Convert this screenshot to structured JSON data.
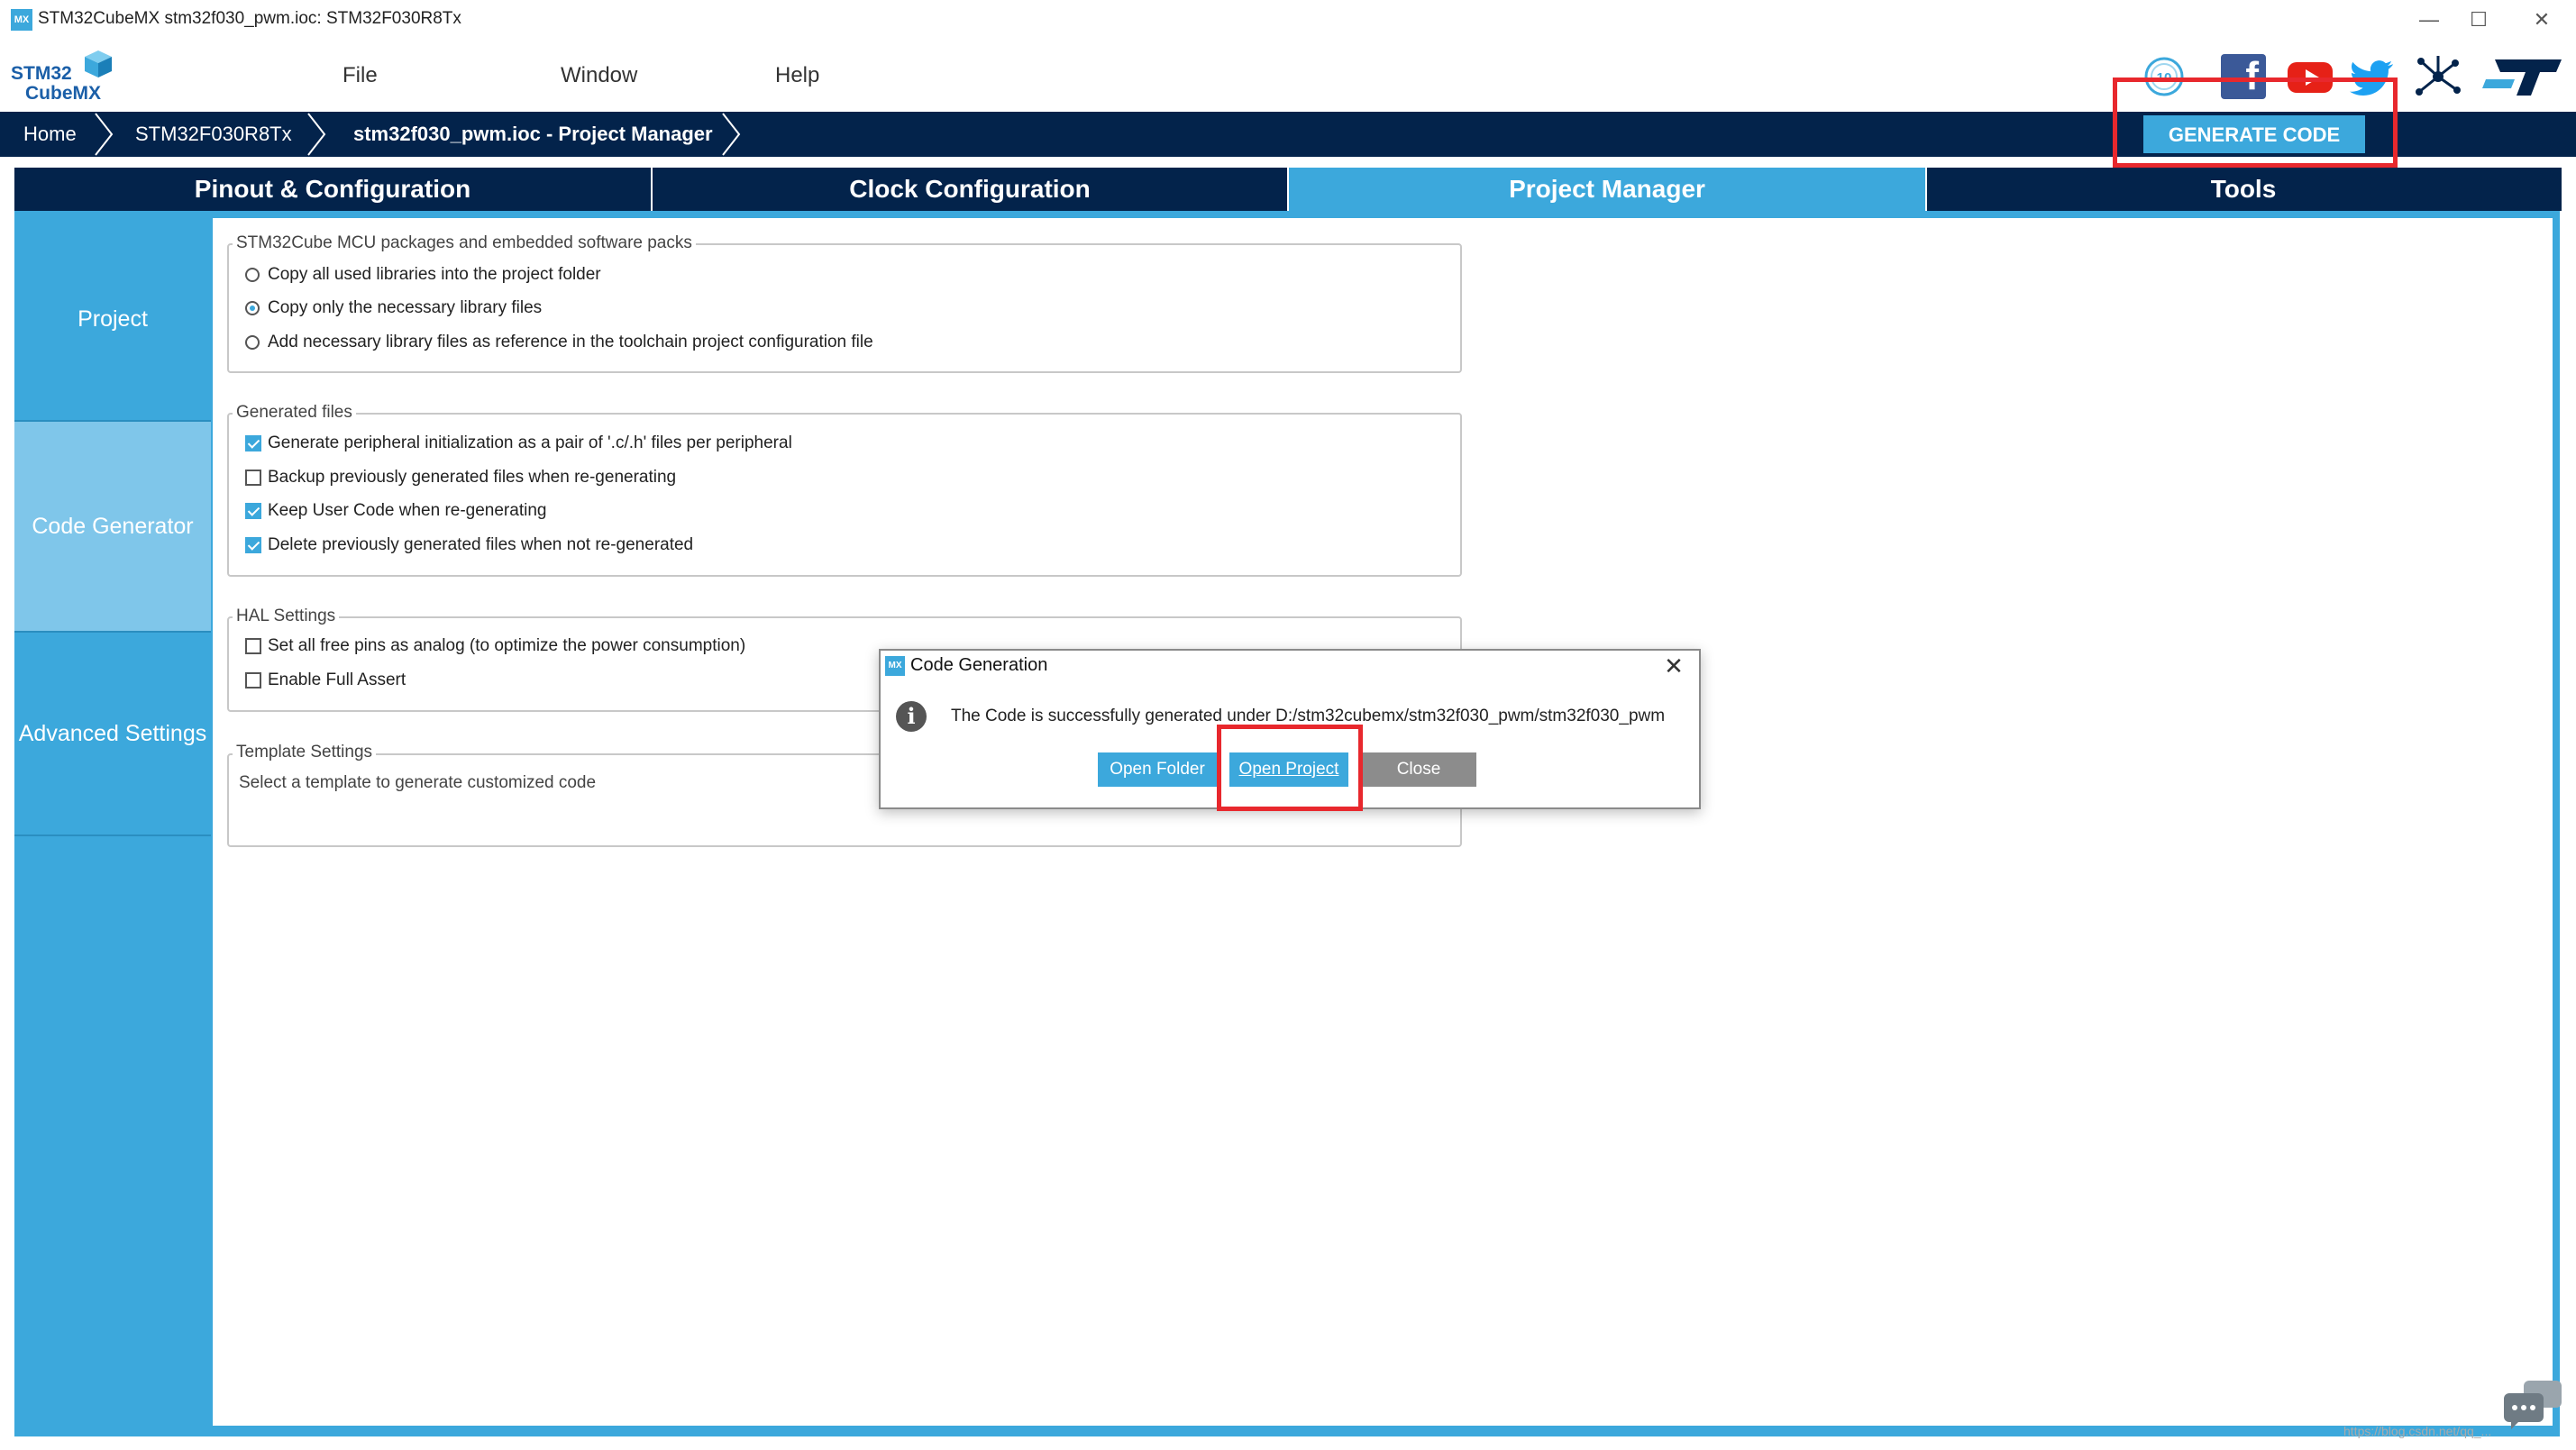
{
  "window": {
    "icon_text": "MX",
    "title": "STM32CubeMX stm32f030_pwm.ioc: STM32F030R8Tx",
    "minimize": "—",
    "maximize": "☐",
    "close": "✕"
  },
  "logo": {
    "line1": "STM32",
    "line2": "CubeMX"
  },
  "menu": [
    "File",
    "Window",
    "Help"
  ],
  "social_icons": [
    "anniversary-icon",
    "facebook-icon",
    "youtube-icon",
    "twitter-icon",
    "network-icon",
    "st-logo-icon"
  ],
  "social": {
    "facebook": "f",
    "st": "ST"
  },
  "breadcrumb": [
    "Home",
    "STM32F030R8Tx",
    "stm32f030_pwm.ioc - Project Manager"
  ],
  "generate_button": "GENERATE CODE",
  "tabs": [
    "Pinout & Configuration",
    "Clock Configuration",
    "Project Manager",
    "Tools"
  ],
  "active_tab": "Project Manager",
  "sidebar": [
    "Project",
    "Code Generator",
    "Advanced Settings"
  ],
  "active_sidebar": "Code Generator",
  "groups": {
    "packs": {
      "legend": "STM32Cube MCU packages and embedded software packs",
      "options": [
        {
          "label": "Copy all used libraries into the project folder",
          "selected": false
        },
        {
          "label": "Copy only the necessary library files",
          "selected": true
        },
        {
          "label": "Add necessary library files as reference in the toolchain project configuration file",
          "selected": false
        }
      ]
    },
    "generated": {
      "legend": "Generated files",
      "options": [
        {
          "label": "Generate peripheral initialization as a pair of '.c/.h' files per peripheral",
          "checked": true
        },
        {
          "label": "Backup previously generated files when re-generating",
          "checked": false
        },
        {
          "label": "Keep User Code when re-generating",
          "checked": true
        },
        {
          "label": "Delete previously generated files when not re-generated",
          "checked": true
        }
      ]
    },
    "hal": {
      "legend": "HAL Settings",
      "options": [
        {
          "label": "Set all free pins as analog (to optimize the power consumption)",
          "checked": false
        },
        {
          "label": "Enable Full Assert",
          "checked": false
        }
      ]
    },
    "template": {
      "legend": "Template Settings",
      "text": "Select a template to generate customized code"
    }
  },
  "dialog": {
    "icon_text": "MX",
    "title": "Code Generation",
    "info_icon": "i",
    "close_icon": "✕",
    "message": "The Code is successfully generated under D:/stm32cubemx/stm32f030_pwm/stm32f030_pwm",
    "buttons": [
      "Open Folder",
      "Open Project",
      "Close"
    ]
  },
  "watermark": "https://blog.csdn.net/qq_...",
  "colors": {
    "accent": "#3ca8dc",
    "navy": "#03234b",
    "highlight": "#e8282d",
    "close_button": "#8c8c8c"
  }
}
